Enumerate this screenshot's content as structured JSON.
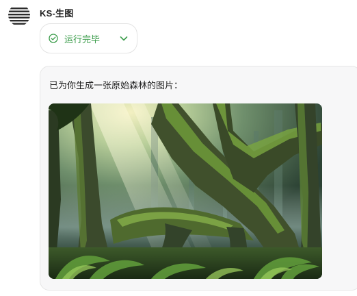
{
  "bot": {
    "name": "KS-生图",
    "avatar_icon": "striped-circle-icon"
  },
  "status": {
    "label": "运行完毕",
    "icon": "check-circle-icon",
    "color": "#3a9c4a",
    "expand_icon": "chevron-down-icon"
  },
  "message": {
    "text": "已为你生成一张原始森林的图片：",
    "image_subject": "ancient-forest-image"
  }
}
